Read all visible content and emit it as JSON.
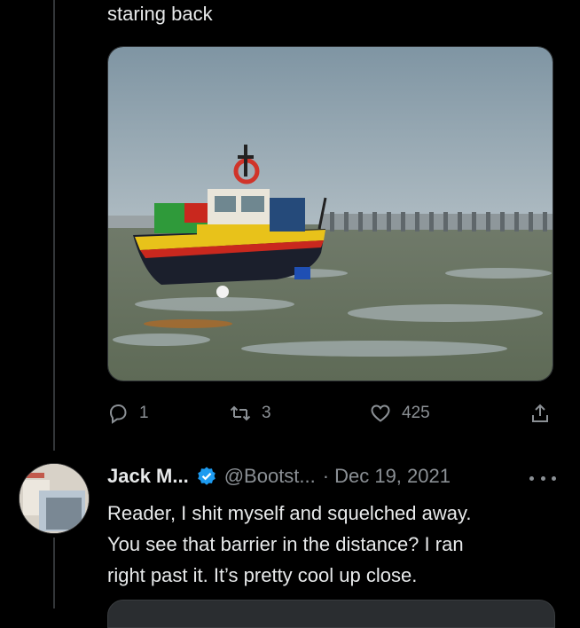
{
  "tweet": {
    "text_tail": "staring back",
    "media_alt": "boat-on-mudflat-photo",
    "actions": {
      "reply_count": "1",
      "retweet_count": "3",
      "like_count": "425"
    }
  },
  "reply": {
    "name": "Jack M...",
    "handle": "@Bootst...",
    "separator": "·",
    "date": "Dec 19, 2021",
    "body_lines": [
      "Reader, I shit myself and squelched away.",
      "You see that barrier in the distance? I ran",
      "right past it. It’s pretty cool up close."
    ]
  },
  "colors": {
    "background": "#000000",
    "text": "#e7e9ea",
    "muted": "#8b9095",
    "verified": "#1d9bf0"
  },
  "icons": [
    "reply-icon",
    "retweet-icon",
    "like-icon",
    "share-icon",
    "verified-badge-icon",
    "more-icon"
  ]
}
